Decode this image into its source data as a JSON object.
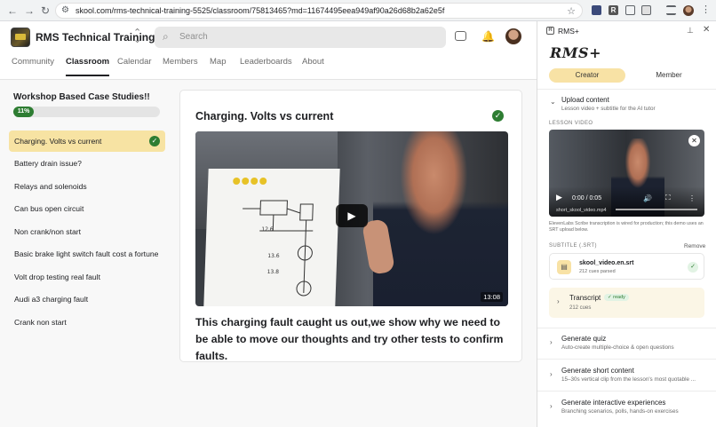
{
  "browser": {
    "url": "skool.com/rms-technical-training-5525/classroom/75813465?md=11674495eea949af90a26d68b2a62e5f",
    "back_icon": "←",
    "forward_icon": "→",
    "reload_icon": "↻",
    "tune_icon": "⚙",
    "star_icon": "☆",
    "extensions": [
      "ext-icon-1",
      "ext-icon-2",
      "puzzle-icon",
      "sidepanel-icon",
      "media-icon"
    ],
    "menu_icon": "⋮"
  },
  "header": {
    "community_name": "RMS Technical Training",
    "switch_icon": "⌃⌄",
    "search_placeholder": "Search",
    "search_icon": "⌕",
    "bell_icon": "🔔"
  },
  "tabs": [
    {
      "label": "Community",
      "active": false
    },
    {
      "label": "Classroom",
      "active": true
    },
    {
      "label": "Calendar",
      "active": false
    },
    {
      "label": "Members",
      "active": false
    },
    {
      "label": "Map",
      "active": false
    },
    {
      "label": "Leaderboards",
      "active": false
    },
    {
      "label": "About",
      "active": false
    }
  ],
  "course": {
    "title": "Workshop Based Case Studies!!",
    "progress_label": "11%",
    "progress": 0.11,
    "lessons": [
      {
        "label": "Charging. Volts vs current",
        "active": true,
        "done": true
      },
      {
        "label": "Battery drain issue?",
        "active": false,
        "done": false
      },
      {
        "label": "Relays and solenoids",
        "active": false,
        "done": false
      },
      {
        "label": "Can bus open circuit",
        "active": false,
        "done": false
      },
      {
        "label": "Non crank/non start",
        "active": false,
        "done": false
      },
      {
        "label": "Basic brake light switch fault cost a fortune",
        "active": false,
        "done": false
      },
      {
        "label": "Volt drop testing real fault",
        "active": false,
        "done": false
      },
      {
        "label": "Audi a3 charging fault",
        "active": false,
        "done": false
      },
      {
        "label": "Crank non start",
        "active": false,
        "done": false
      }
    ]
  },
  "lesson": {
    "title": "Charging. Volts vs current",
    "check_icon": "✓",
    "play_icon": "▶",
    "duration": "13:08",
    "description": "This charging fault caught us out,we show why we need to be able to move our thoughts and try other tests to confirm faults."
  },
  "panel": {
    "header_name": "RMS+",
    "header_icon": "R",
    "pin_icon": "✕",
    "close_icon": "✕",
    "logo": "RMS+",
    "segments": [
      {
        "label": "Creator",
        "active": true
      },
      {
        "label": "Member",
        "active": false
      }
    ],
    "upload": {
      "chevron": "⌄",
      "title": "Upload content",
      "subtitle": "Lesson video + subtitle for the AI tutor"
    },
    "lesson_video_label": "LESSON VIDEO",
    "video": {
      "time": "0:00 / 0:05",
      "file": "short_skool_video.mp4",
      "close_icon": "✕",
      "play_icon": "▶",
      "volume_icon": "🔊",
      "fullscreen_icon": "⛶",
      "more_icon": "⋮"
    },
    "note": "ElevenLabs Scribe transcription is wired for production; this demo uses an SRT upload below.",
    "subtitle_label": "SUBTITLE (.SRT)",
    "remove_label": "Remove",
    "srt": {
      "file_icon": "▤",
      "name": "skool_video.en.srt",
      "cues": "212 cues parsed",
      "ok_icon": "✓"
    },
    "transcript": {
      "chevron": "›",
      "title": "Transcript",
      "badge": "✓ ready",
      "cues": "212 cues"
    },
    "sections": [
      {
        "title": "Generate quiz",
        "subtitle": "Auto-create multiple-choice & open questions"
      },
      {
        "title": "Generate short content",
        "subtitle": "15–30s vertical clip from the lesson's most quotable ..."
      },
      {
        "title": "Generate interactive experiences",
        "subtitle": "Branching scenarios, polls, hands-on exercises"
      }
    ],
    "section_chevron": "›"
  },
  "colors": {
    "accent_yellow": "#f7e3a3",
    "success_green": "#2e7d32"
  }
}
